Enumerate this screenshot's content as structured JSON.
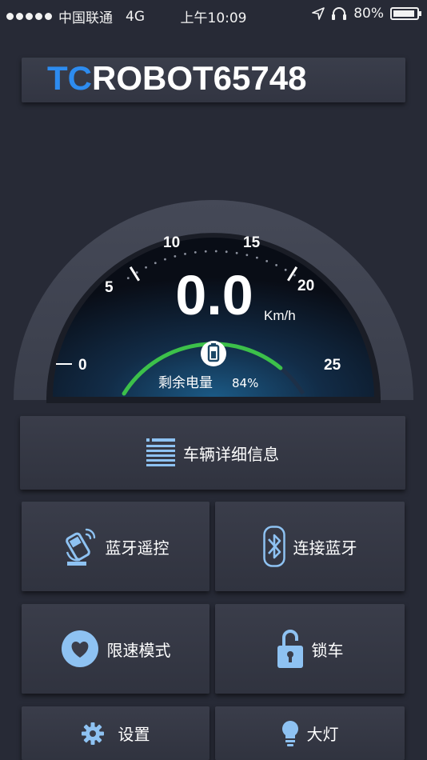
{
  "status_bar": {
    "carrier": "中国联通",
    "network": "4G",
    "time": "上午10:09",
    "battery": "80%",
    "icons": [
      "signal-dots-icon",
      "location-arrow-icon",
      "headphones-icon",
      "battery-icon"
    ]
  },
  "device": {
    "name_prefix": "TC",
    "name_rest": "ROBOT65748"
  },
  "gauge": {
    "speed": "0.0",
    "unit": "Km/h",
    "ticks": [
      "0",
      "5",
      "10",
      "15",
      "20",
      "25"
    ],
    "battery_label": "剩余电量",
    "battery_value": "84%",
    "battery_level": 0.84
  },
  "menu": {
    "details": "车辆详细信息",
    "bt_remote": "蓝牙遥控",
    "bt_connect": "连接蓝牙",
    "speed_limit": "限速模式",
    "lock": "锁车",
    "settings": "设置",
    "headlight": "大灯"
  },
  "colors": {
    "accent": "#2d8cf0",
    "battery_arc": "#3cc04a",
    "background": "#272a36",
    "icon": "#8ec2f2"
  }
}
